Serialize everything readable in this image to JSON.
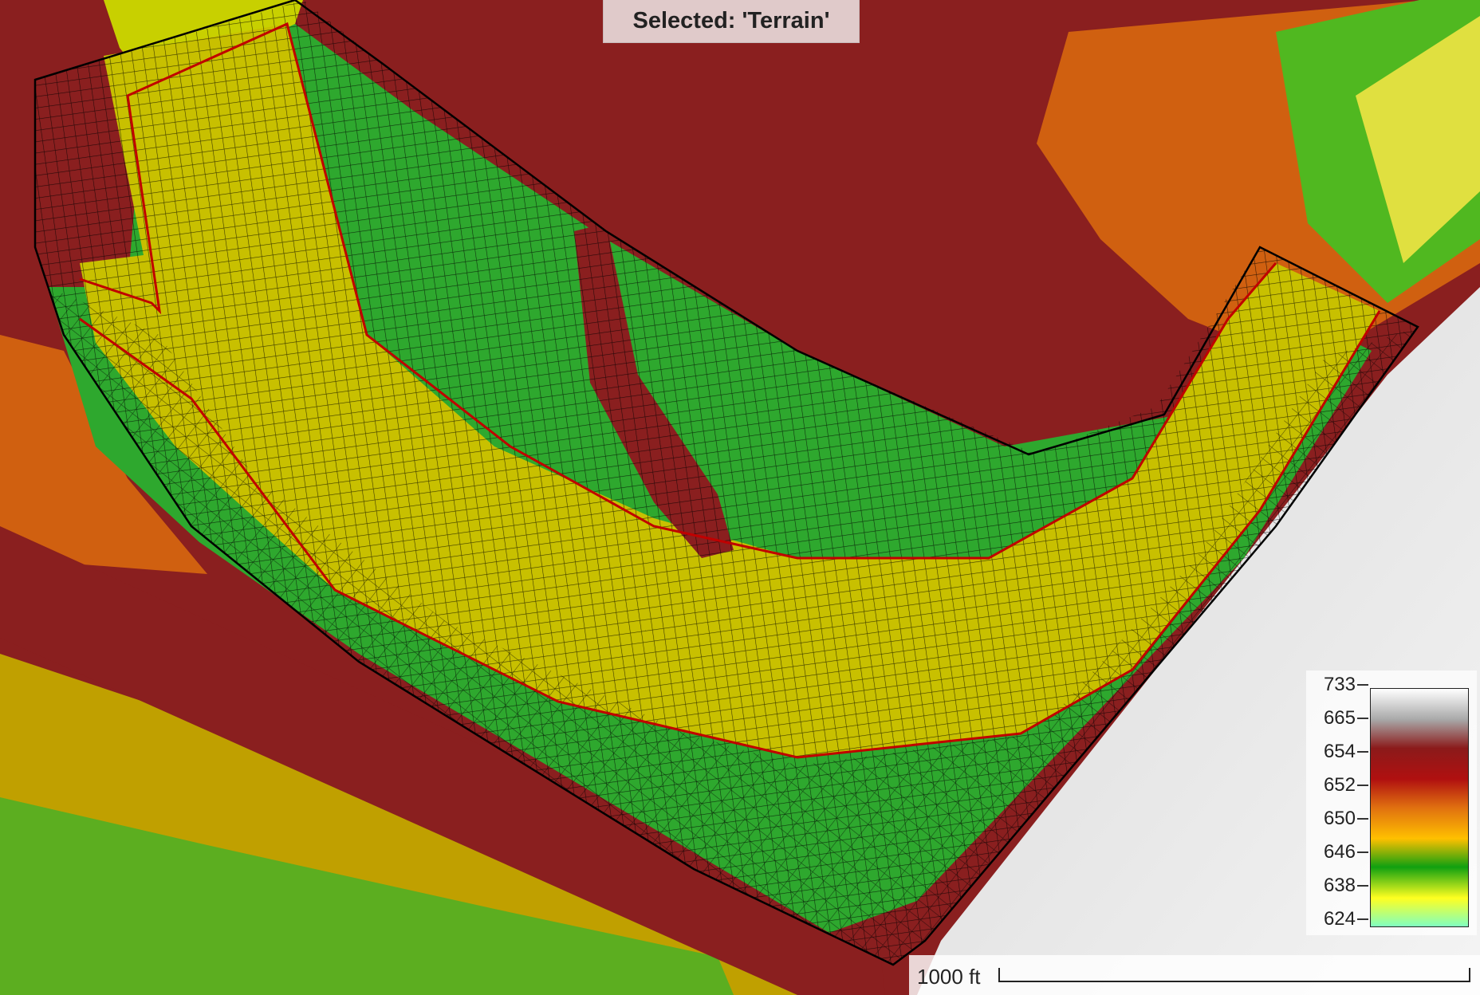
{
  "selection": {
    "text": "Selected: 'Terrain'"
  },
  "legend": {
    "labels": [
      "733",
      "665",
      "654",
      "652",
      "650",
      "646",
      "638",
      "624"
    ],
    "colors": [
      "#ffffff",
      "#a8a8a8",
      "#8b1a1a",
      "#b01010",
      "#e07010",
      "#ffc000",
      "#10a010",
      "#ffff20",
      "#80ffc0"
    ]
  },
  "scale_bar": {
    "label": "1000 ft"
  },
  "colors": {
    "terrain_high": "#8a1f1f",
    "terrain_mid": "#c8c000",
    "terrain_low": "#2ea82e",
    "mesh_line": "#000000",
    "breakline": "#c00000"
  }
}
